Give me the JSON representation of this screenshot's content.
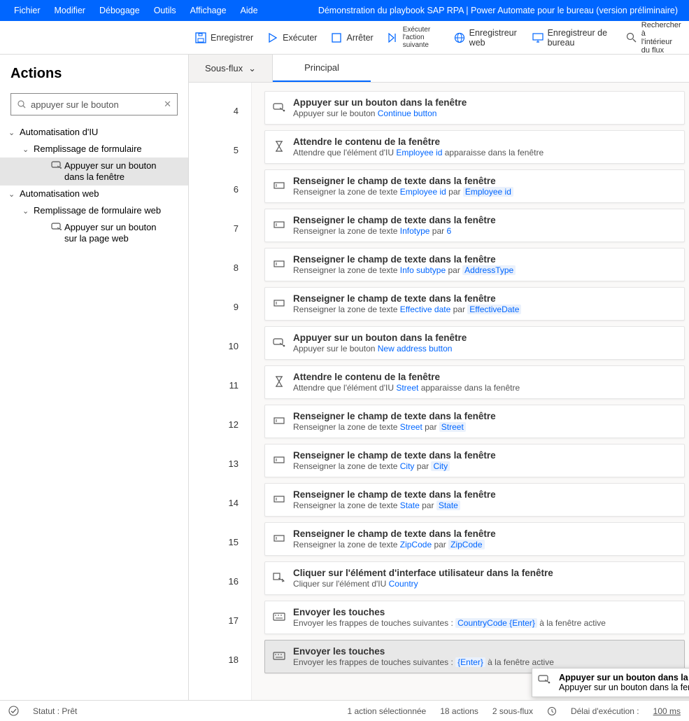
{
  "menu": [
    "Fichier",
    "Modifier",
    "Débogage",
    "Outils",
    "Affichage",
    "Aide"
  ],
  "title": "Démonstration du playbook SAP RPA | Power Automate pour le bureau (version préliminaire)",
  "toolbar": {
    "save": "Enregistrer",
    "run": "Exécuter",
    "stop": "Arrêter",
    "next_line1": "Exécuter l'action",
    "next_line2": "suivante",
    "web_rec": "Enregistreur web",
    "desk_rec": "Enregistreur de bureau",
    "search_line1": "Rechercher à",
    "search_line2": "l'intérieur du flux"
  },
  "sidebar": {
    "heading": "Actions",
    "search_value": "appuyer sur le bouton",
    "tree": {
      "ui_auto": "Automatisation d'IU",
      "form_fill": "Remplissage de formulaire",
      "press_btn_window_1": "Appuyer sur un bouton",
      "press_btn_window_2": "dans la fenêtre",
      "web_auto": "Automatisation web",
      "web_form_fill": "Remplissage de formulaire web",
      "press_btn_page_1": "Appuyer sur un bouton",
      "press_btn_page_2": "sur la page web"
    }
  },
  "tabs": {
    "subflows": "Sous-flux",
    "main": "Principal"
  },
  "steps": [
    {
      "n": 4,
      "icon": "click",
      "title": "Appuyer sur un bouton dans la fenêtre",
      "desc_pre": "Appuyer sur le bouton ",
      "link": "Continue button",
      "desc_post": ""
    },
    {
      "n": 5,
      "icon": "wait",
      "title": "Attendre le contenu de la fenêtre",
      "desc_pre": "Attendre que l'élément d'IU ",
      "link": "Employee id",
      "desc_post": " apparaisse dans la fenêtre"
    },
    {
      "n": 6,
      "icon": "text",
      "title": "Renseigner le champ de texte dans la fenêtre",
      "desc_pre": "Renseigner la zone de texte ",
      "link": "Employee id",
      "mid": " par ",
      "token": "Employee id"
    },
    {
      "n": 7,
      "icon": "text",
      "title": "Renseigner le champ de texte dans la fenêtre",
      "desc_pre": "Renseigner la zone de texte ",
      "link": "Infotype",
      "mid": " par ",
      "link2": "6"
    },
    {
      "n": 8,
      "icon": "text",
      "title": "Renseigner le champ de texte dans la fenêtre",
      "desc_pre": "Renseigner la zone de texte ",
      "link": "Info subtype",
      "mid": " par ",
      "token": "AddressType"
    },
    {
      "n": 9,
      "icon": "text",
      "title": "Renseigner le champ de texte dans la fenêtre",
      "desc_pre": "Renseigner la zone de texte ",
      "link": "Effective date",
      "mid": " par ",
      "token": "EffectiveDate"
    },
    {
      "n": 10,
      "icon": "click",
      "title": "Appuyer sur un bouton dans la fenêtre",
      "desc_pre": "Appuyer sur le bouton ",
      "link": "New address button"
    },
    {
      "n": 11,
      "icon": "wait",
      "title": "Attendre le contenu de la fenêtre",
      "desc_pre": "Attendre que l'élément d'IU ",
      "link": "Street",
      "desc_post": " apparaisse dans la fenêtre"
    },
    {
      "n": 12,
      "icon": "text",
      "title": "Renseigner le champ de texte dans la fenêtre",
      "desc_pre": "Renseigner la zone de texte ",
      "link": "Street",
      "mid": " par ",
      "token": "Street"
    },
    {
      "n": 13,
      "icon": "text",
      "title": "Renseigner le champ de texte dans la fenêtre",
      "desc_pre": "Renseigner la zone de texte ",
      "link": "City",
      "mid": " par ",
      "token": "City"
    },
    {
      "n": 14,
      "icon": "text",
      "title": "Renseigner le champ de texte dans la fenêtre",
      "desc_pre": "Renseigner la zone de texte ",
      "link": "State",
      "mid": " par ",
      "token": "State"
    },
    {
      "n": 15,
      "icon": "text",
      "title": "Renseigner le champ de texte dans la fenêtre",
      "desc_pre": "Renseigner la zone de texte ",
      "link": "ZipCode",
      "mid": " par ",
      "token": "ZipCode"
    },
    {
      "n": 16,
      "icon": "uiclick",
      "title": "Cliquer sur l'élément d'interface utilisateur dans la fenêtre",
      "desc_pre": "Cliquer sur l'élément d'IU ",
      "link": "Country"
    },
    {
      "n": 17,
      "icon": "keys",
      "title": "Envoyer les touches",
      "desc_pre": "Envoyer les frappes de touches suivantes : ",
      "token": "CountryCode {Enter}",
      "desc_post": " à la fenêtre active"
    },
    {
      "n": 18,
      "icon": "keys",
      "title": "Envoyer les touches",
      "desc_pre": "Envoyer les frappes de touches suivantes : ",
      "token": "{Enter}",
      "desc_post": " à la fenêtre active",
      "selected": true
    }
  ],
  "drag": {
    "title": "Appuyer sur un bouton dans la fenêtre",
    "desc": "Appuyer sur un bouton dans la fenêtre"
  },
  "status": {
    "ready": "Statut : Prêt",
    "sel": "1 action sélectionnée",
    "actions": "18 actions",
    "subs": "2 sous-flux",
    "delay_label": "Délai d'exécution :",
    "delay_val": "100 ms"
  }
}
